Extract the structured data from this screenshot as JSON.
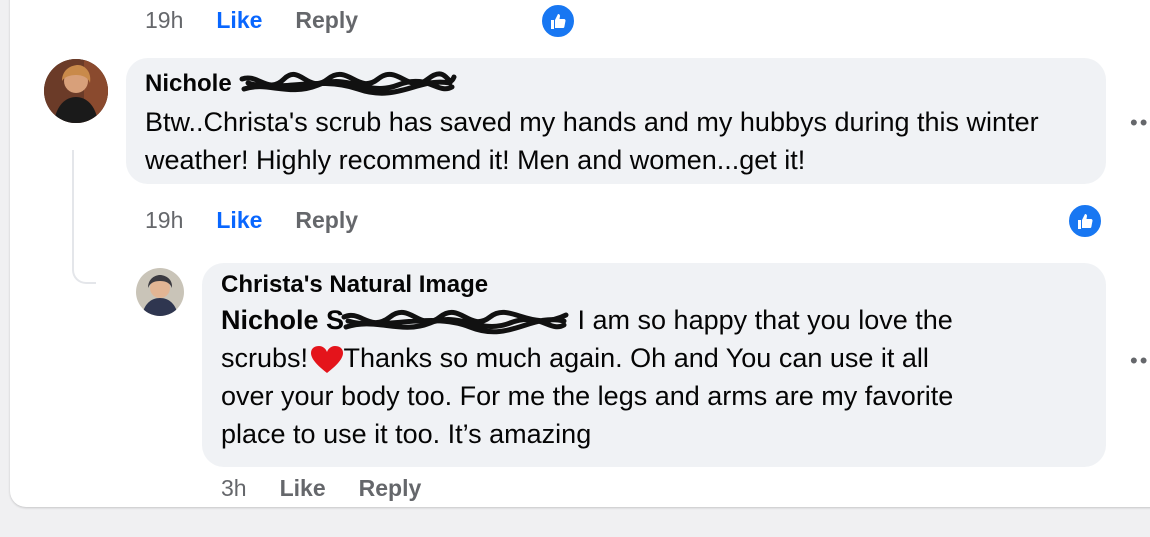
{
  "top_meta": {
    "time": "19h",
    "like": "Like",
    "reply": "Reply"
  },
  "comment1": {
    "author": "Nichole",
    "text": "Btw..Christa's scrub has saved my hands and my hubbys during this winter weather! Highly recommend it! Men and women...get it!",
    "time": "19h",
    "like": "Like",
    "reply": "Reply"
  },
  "comment2": {
    "author": "Christa's Natural Image",
    "mention": "Nichole S",
    "text_line1": " I am so happy that you love the",
    "text_line2a": "scrubs! ",
    "heart": "❤️",
    "text_line2b": "Thanks so much again. Oh and You can use it all",
    "text_line3": "over your body too. For me the legs and arms are my favorite",
    "text_line4": "place to use it too. It’s amazing",
    "time": "3h",
    "like": "Like",
    "reply": "Reply"
  },
  "icons": {
    "reaction": "thumbs-up-icon",
    "more": "more-options-icon",
    "accent": "#1877f2"
  }
}
